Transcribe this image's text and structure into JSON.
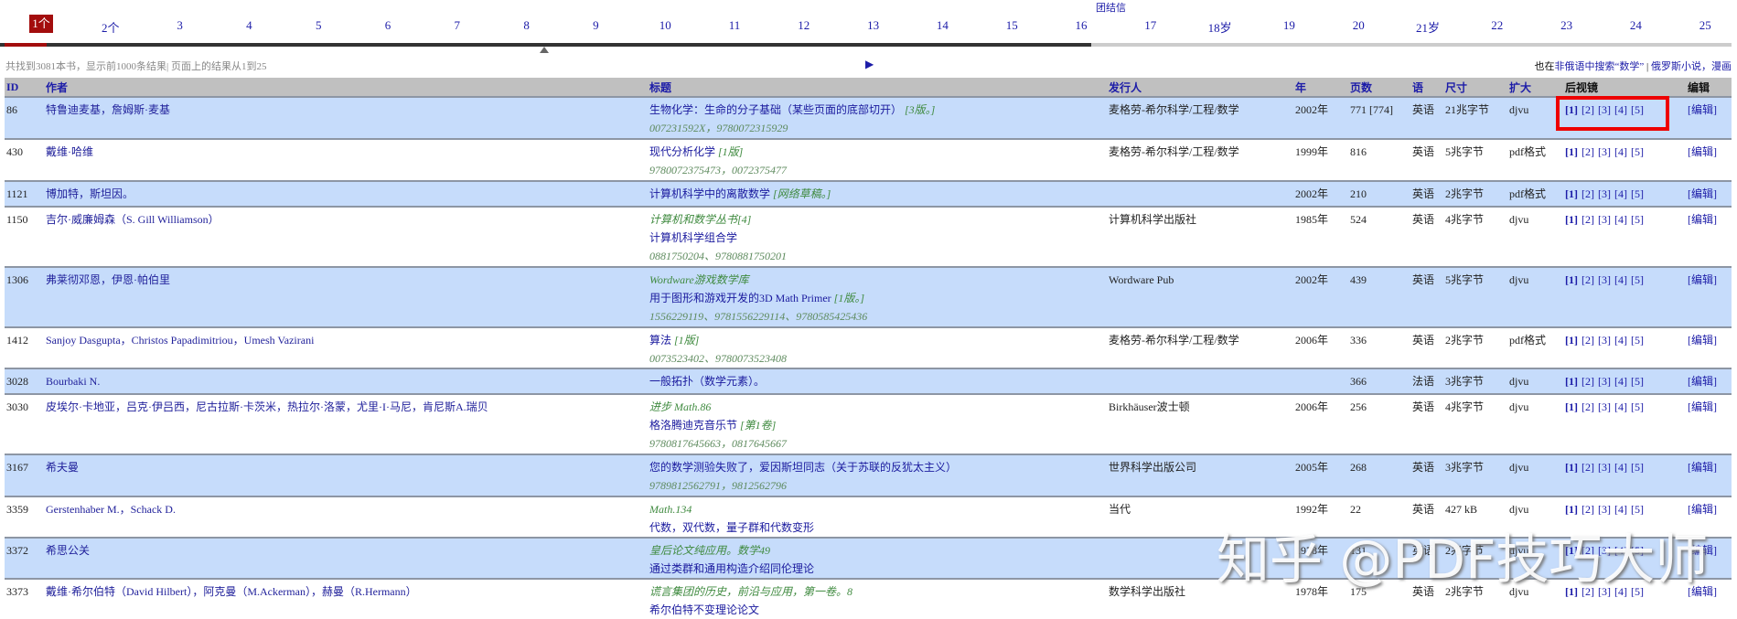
{
  "pager": {
    "pages": [
      "1个",
      "2个",
      "3",
      "4",
      "5",
      "6",
      "7",
      "8",
      "9",
      "10",
      "11",
      "12",
      "13",
      "14",
      "15",
      "16",
      "17",
      "18岁",
      "19",
      "20",
      "21岁",
      "22",
      "23",
      "24",
      "25"
    ],
    "current": 0,
    "hint": "团结信"
  },
  "info": "共找到3081本书，显示前1000条结果| 页面上的结果从1到25",
  "also": {
    "prefix": "也在",
    "link1": "非俄语中搜索“数学”",
    "sep": " | ",
    "link2": "俄罗斯小说，漫画"
  },
  "headers": {
    "id": "ID",
    "author": "作者",
    "title": "标题",
    "publisher": "发行人",
    "year": "年",
    "pages": "页数",
    "lang": "语",
    "size": "尺寸",
    "ext": "扩大",
    "mirrors": "后视镜",
    "edit": "编辑"
  },
  "mirror_labels": [
    "[1]",
    "[2]",
    "[3]",
    "[4]",
    "[5]"
  ],
  "edit_label": "[编辑]",
  "rows": [
    {
      "id": "86",
      "author": "特鲁迪麦基，詹姆斯·麦基",
      "series": "",
      "title": "生物化学：生命的分子基础（某些页面的底部切开）",
      "ed": " [3版。]",
      "isbn": "007231592X，9780072315929",
      "publisher": "麦格劳-希尔科学/工程/数学",
      "year": "2002年",
      "pages": "771 [774]",
      "lang": "英语",
      "size": "21兆字节",
      "ext": "djvu"
    },
    {
      "id": "430",
      "author": "戴维·哈维",
      "series": "",
      "title": "现代分析化学",
      "ed": " [1版]",
      "isbn": "9780072375473，0072375477",
      "publisher": "麦格劳-希尔科学/工程/数学",
      "year": "1999年",
      "pages": "816",
      "lang": "英语",
      "size": "5兆字节",
      "ext": "pdf格式"
    },
    {
      "id": "1121",
      "author": "博加特，斯坦因。",
      "series": "",
      "title": "计算机科学中的离散数学",
      "ed": " [网络草稿。]",
      "isbn": "",
      "publisher": "",
      "year": "2002年",
      "pages": "210",
      "lang": "英语",
      "size": "2兆字节",
      "ext": "pdf格式"
    },
    {
      "id": "1150",
      "author": "吉尔·威廉姆森（S. Gill Williamson）",
      "series": "计算机和数学丛书[4]",
      "title": "计算机科学组合学",
      "ed": "",
      "isbn": "0881750204、9780881750201",
      "publisher": "计算机科学出版社",
      "year": "1985年",
      "pages": "524",
      "lang": "英语",
      "size": "4兆字节",
      "ext": "djvu"
    },
    {
      "id": "1306",
      "author": "弗莱彻邓恩，伊恩·帕伯里",
      "series": "Wordware游戏数学库",
      "title": "用于图形和游戏开发的3D Math Primer",
      "ed": " [1版。]",
      "isbn": "1556229119、9781556229114、9780585425436",
      "publisher": "Wordware Pub",
      "year": "2002年",
      "pages": "439",
      "lang": "英语",
      "size": "5兆字节",
      "ext": "djvu"
    },
    {
      "id": "1412",
      "author": "Sanjoy Dasgupta，Christos Papadimitriou，Umesh Vazirani",
      "series": "",
      "title": "算法",
      "ed": " [1版]",
      "isbn": "0073523402、9780073523408",
      "publisher": "麦格劳-希尔科学/工程/数学",
      "year": "2006年",
      "pages": "336",
      "lang": "英语",
      "size": "2兆字节",
      "ext": "pdf格式"
    },
    {
      "id": "3028",
      "author": "Bourbaki N.",
      "series": "",
      "title": "一般拓扑（数学元素）。",
      "ed": "",
      "isbn": "",
      "publisher": "",
      "year": "",
      "pages": "366",
      "lang": "法语",
      "size": "3兆字节",
      "ext": "djvu"
    },
    {
      "id": "3030",
      "author": "皮埃尔·卡地亚，吕克·伊吕西，尼古拉斯·卡茨米，热拉尔·洛蒙，尤里·I·马尼，肯尼斯A.瑞贝",
      "series": "进步 Math.86",
      "title": "格洛腾迪克音乐节",
      "ed": " [第1卷]",
      "isbn": "9780817645663，0817645667",
      "publisher": "Birkhäuser波士顿",
      "year": "2006年",
      "pages": "256",
      "lang": "英语",
      "size": "4兆字节",
      "ext": "djvu"
    },
    {
      "id": "3167",
      "author": "希夫曼",
      "series": "",
      "title": "您的数学测验失败了，爱因斯坦同志（关于苏联的反犹太主义）",
      "ed": "",
      "isbn": "9789812562791，9812562796",
      "publisher": "世界科学出版公司",
      "year": "2005年",
      "pages": "268",
      "lang": "英语",
      "size": "3兆字节",
      "ext": "djvu"
    },
    {
      "id": "3359",
      "author": "Gerstenhaber M.，Schack D.",
      "series": "Math.134",
      "title": "代数，双代数，量子群和代数变形",
      "ed": "",
      "isbn": "",
      "publisher": "当代",
      "year": "1992年",
      "pages": "22",
      "lang": "英语",
      "size": "427 kB",
      "ext": "djvu"
    },
    {
      "id": "3372",
      "author": "希思公关",
      "series": "皇后论文纯应用。数学49",
      "title": "通过类群和通用构造介绍同伦理论",
      "ed": "",
      "isbn": "",
      "publisher": "",
      "year": "1978年",
      "pages": "131",
      "lang": "英语",
      "size": "2兆字节",
      "ext": "djvu"
    },
    {
      "id": "3373",
      "author": "戴维·希尔伯特（David Hilbert），阿克曼（M.Ackerman），赫曼（R.Hermann）",
      "series": "谎言集团的历史，前沿与应用，第一卷。8",
      "title": "希尔伯特不变理论论文",
      "ed": "",
      "isbn": "",
      "publisher": "数学科学出版社",
      "year": "1978年",
      "pages": "175",
      "lang": "英语",
      "size": "2兆字节",
      "ext": "djvu"
    }
  ],
  "watermark": "知乎 @PDF技巧大师",
  "colors": {
    "row_alt": "#c6dcfb",
    "header": "#c0c0c0",
    "link": "#1c1ca8",
    "current_page": "#a30d0d",
    "highlight_box": "#ee0000"
  }
}
